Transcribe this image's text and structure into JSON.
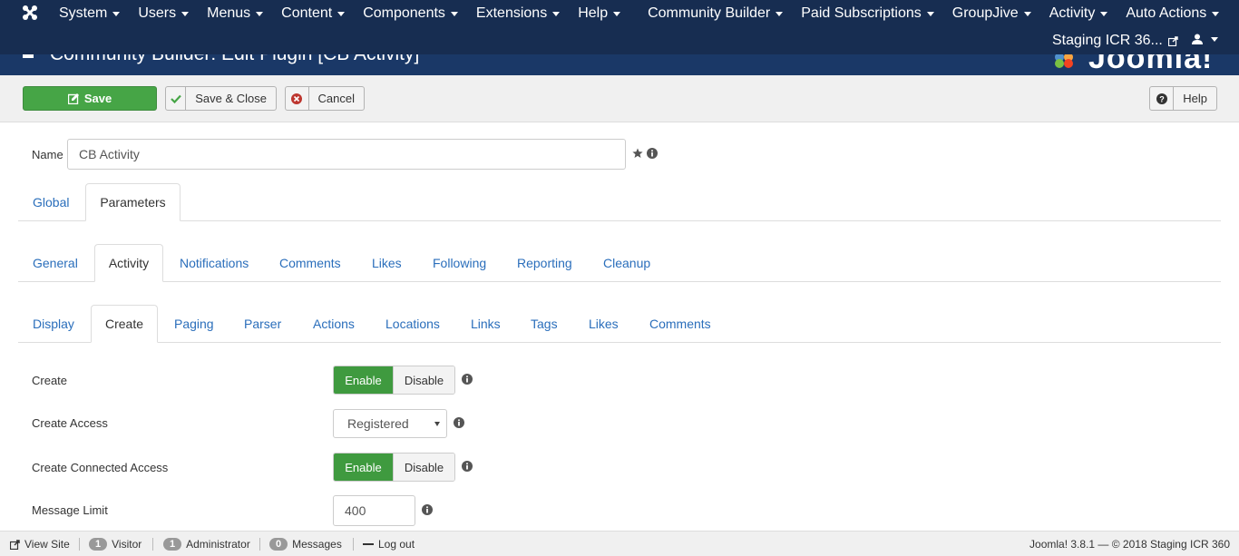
{
  "nav": {
    "menu": [
      "System",
      "Users",
      "Menus",
      "Content",
      "Components",
      "Extensions",
      "Help"
    ],
    "ext_menu": [
      "Community Builder",
      "Paid Subscriptions",
      "GroupJive",
      "Activity",
      "Auto Actions"
    ],
    "site_link": "Staging ICR 36...",
    "icons": {
      "logo": "joomla-logo-icon",
      "external": "external-link-icon",
      "user": "user-icon"
    }
  },
  "page": {
    "title": "Community Builder: Edit Plugin [CB Activity]",
    "brand": "Joomla!"
  },
  "toolbar": {
    "save": "Save",
    "save_close": "Save & Close",
    "cancel": "Cancel",
    "help": "Help"
  },
  "form": {
    "name_label": "Name",
    "name_value": "CB Activity"
  },
  "tabs": {
    "main": [
      "Global",
      "Parameters"
    ],
    "main_active": "Parameters",
    "section": [
      "General",
      "Activity",
      "Notifications",
      "Comments",
      "Likes",
      "Following",
      "Reporting",
      "Cleanup"
    ],
    "section_active": "Activity",
    "sub": [
      "Display",
      "Create",
      "Paging",
      "Parser",
      "Actions",
      "Locations",
      "Links",
      "Tags",
      "Likes",
      "Comments"
    ],
    "sub_active": "Create"
  },
  "params": {
    "create": {
      "label": "Create",
      "on": "Enable",
      "off": "Disable",
      "selected": "Enable"
    },
    "create_access": {
      "label": "Create Access",
      "value": "Registered"
    },
    "create_connected": {
      "label": "Create Connected Access",
      "on": "Enable",
      "off": "Disable",
      "selected": "Enable"
    },
    "message_limit": {
      "label": "Message Limit",
      "value": "400"
    }
  },
  "status": {
    "view_site": "View Site",
    "visitor_count": "1",
    "visitor": "Visitor",
    "admin_count": "1",
    "admin": "Administrator",
    "messages_count": "0",
    "messages": "Messages",
    "logout": "Log out",
    "footer": "Joomla! 3.8.1 — © 2018 Staging ICR 360"
  },
  "colors": {
    "nav_bg": "#172d51",
    "save_green": "#46a546",
    "toggle_green": "#3f9a3f",
    "link_blue": "#2a6ebb"
  }
}
